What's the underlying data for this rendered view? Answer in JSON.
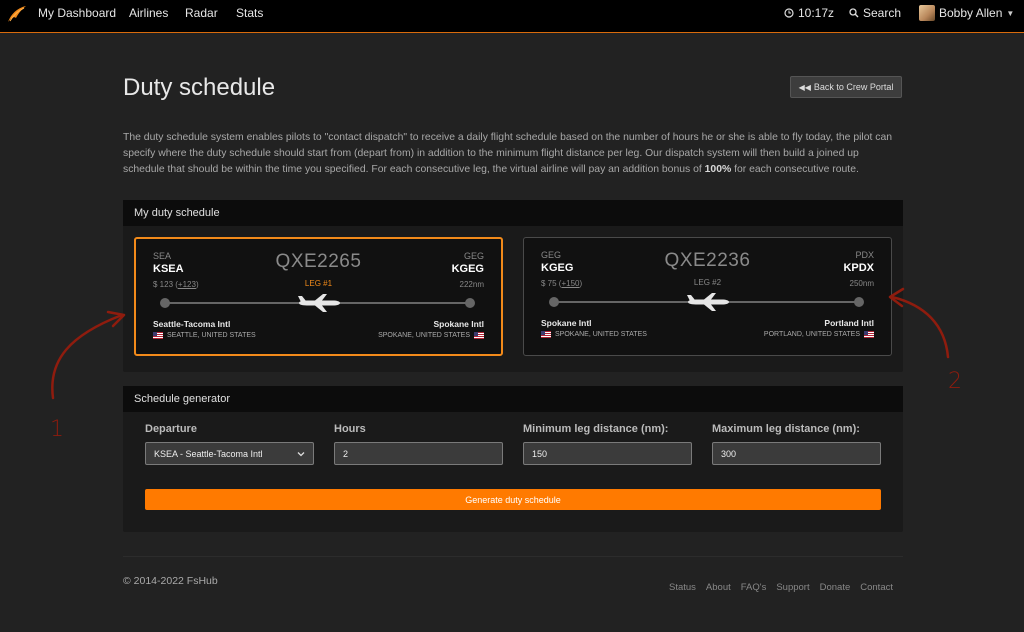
{
  "nav": {
    "links": [
      "My Dashboard",
      "Airlines",
      "Radar",
      "Stats"
    ],
    "time": "10:17z",
    "search_label": "Search",
    "user_name": "Bobby Allen"
  },
  "header": {
    "title": "Duty schedule",
    "back_button": "Back to Crew Portal"
  },
  "intro": {
    "part1": "The duty schedule system enables pilots to \"contact dispatch\" to receive a daily flight schedule based on the number of hours he or she is able to fly today, the pilot can specify where the duty schedule should start from (depart from) in addition to the minimum flight distance per leg. Our dispatch system will then build a joined up schedule that should be within the time you specified. For each consecutive leg, the virtual airline will pay an addition bonus of ",
    "bonus": "100%",
    "part2": " for each consecutive route."
  },
  "duty_panel": {
    "title": "My duty schedule",
    "legs": [
      {
        "flight": "QXE2265",
        "leg_label": "LEG #1",
        "active": true,
        "from_code": "SEA",
        "from_icao": "KSEA",
        "to_code": "GEG",
        "to_icao": "KGEG",
        "price": "$ 123",
        "bonus": "+123",
        "distance": "222nm",
        "from_name": "Seattle-Tacoma Intl",
        "from_country": "SEATTLE, UNITED STATES",
        "to_name": "Spokane Intl",
        "to_country": "SPOKANE, UNITED STATES"
      },
      {
        "flight": "QXE2236",
        "leg_label": "LEG #2",
        "active": false,
        "from_code": "GEG",
        "from_icao": "KGEG",
        "to_code": "PDX",
        "to_icao": "KPDX",
        "price": "$ 75",
        "bonus": "+150",
        "distance": "250nm",
        "from_name": "Spokane Intl",
        "from_country": "SPOKANE, UNITED STATES",
        "to_name": "Portland Intl",
        "to_country": "PORTLAND, UNITED STATES"
      }
    ]
  },
  "generator": {
    "title": "Schedule generator",
    "departure_label": "Departure",
    "departure_value": "KSEA - Seattle-Tacoma Intl",
    "hours_label": "Hours",
    "hours_value": "2",
    "min_label": "Minimum leg distance (nm):",
    "min_value": "150",
    "max_label": "Maximum leg distance (nm):",
    "max_value": "300",
    "button": "Generate duty schedule"
  },
  "footer": {
    "copyright": "© 2014-2022 FsHub",
    "links": [
      "Status",
      "About",
      "FAQ's",
      "Support",
      "Donate",
      "Contact"
    ]
  },
  "annotations": [
    "1",
    "2"
  ],
  "colors": {
    "accent": "#ff7a00",
    "annotation": "#8f1c0e",
    "background": "#222222"
  }
}
